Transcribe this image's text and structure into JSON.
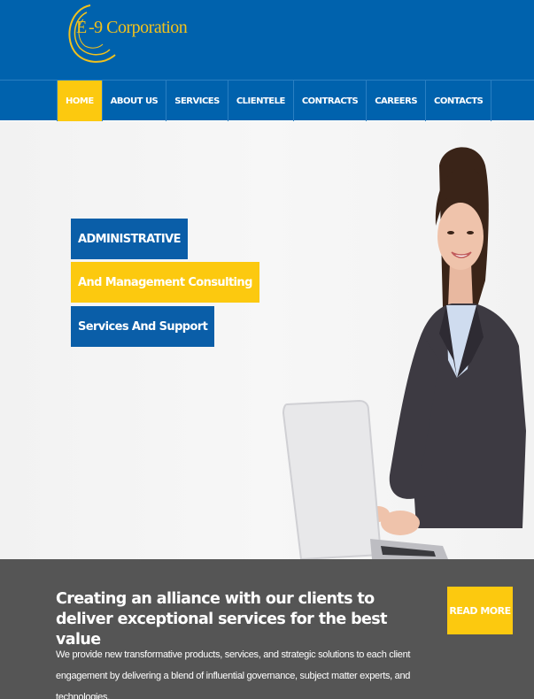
{
  "brand": {
    "logo_letter": "E",
    "logo_text": "-9  Corporation",
    "accent_color": "#fcc90f",
    "primary_color": "#0062ad"
  },
  "nav": {
    "items": [
      {
        "label": "HOME",
        "active": true
      },
      {
        "label": "ABOUT US",
        "active": false
      },
      {
        "label": "SERVICES",
        "active": false
      },
      {
        "label": "CLIENTELE",
        "active": false
      },
      {
        "label": "CONTRACTS",
        "active": false
      },
      {
        "label": "CAREERS",
        "active": false
      },
      {
        "label": "CONTACTS",
        "active": false
      }
    ]
  },
  "hero": {
    "tag1": "ADMINISTRATIVE",
    "tag2": "And Management Consulting",
    "tag3": "Services And Support",
    "image": "woman-with-laptop"
  },
  "band": {
    "title": "Creating an alliance with our clients to deliver exceptional services for the best value",
    "text": "We provide new transformative products, services, and strategic solutions to each client engagement by delivering a blend of influential governance, subject matter experts, and technologies.",
    "button_label": "READ MORE"
  }
}
